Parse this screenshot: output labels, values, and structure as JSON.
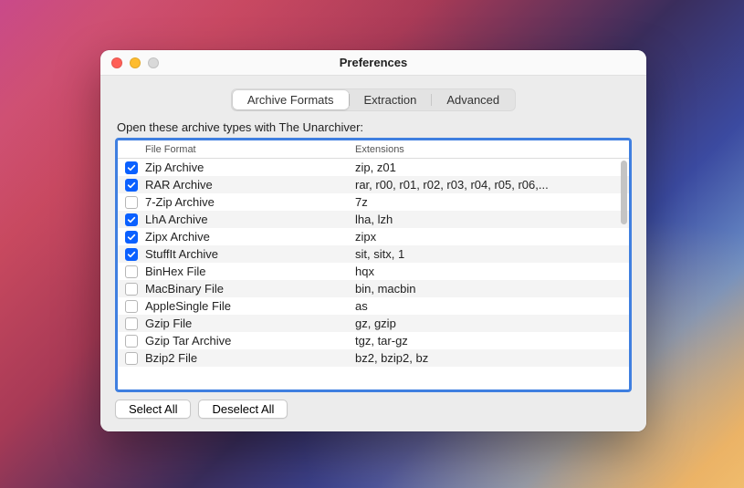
{
  "window": {
    "title": "Preferences"
  },
  "tabs": [
    {
      "label": "Archive Formats",
      "active": true
    },
    {
      "label": "Extraction",
      "active": false
    },
    {
      "label": "Advanced",
      "active": false
    }
  ],
  "instruction": "Open these archive types with The Unarchiver:",
  "columns": {
    "format": "File Format",
    "extensions": "Extensions"
  },
  "rows": [
    {
      "checked": true,
      "format": "Zip Archive",
      "ext": "zip, z01"
    },
    {
      "checked": true,
      "format": "RAR Archive",
      "ext": "rar, r00, r01, r02, r03, r04, r05, r06,..."
    },
    {
      "checked": false,
      "format": "7-Zip Archive",
      "ext": "7z"
    },
    {
      "checked": true,
      "format": "LhA Archive",
      "ext": "lha, lzh"
    },
    {
      "checked": true,
      "format": "Zipx Archive",
      "ext": "zipx"
    },
    {
      "checked": true,
      "format": "StuffIt Archive",
      "ext": "sit, sitx, 1"
    },
    {
      "checked": false,
      "format": "BinHex File",
      "ext": "hqx"
    },
    {
      "checked": false,
      "format": "MacBinary File",
      "ext": "bin, macbin"
    },
    {
      "checked": false,
      "format": "AppleSingle File",
      "ext": "as"
    },
    {
      "checked": false,
      "format": "Gzip File",
      "ext": "gz, gzip"
    },
    {
      "checked": false,
      "format": "Gzip Tar Archive",
      "ext": "tgz, tar-gz"
    },
    {
      "checked": false,
      "format": "Bzip2 File",
      "ext": "bz2, bzip2, bz"
    }
  ],
  "buttons": {
    "select_all": "Select All",
    "deselect_all": "Deselect All"
  }
}
